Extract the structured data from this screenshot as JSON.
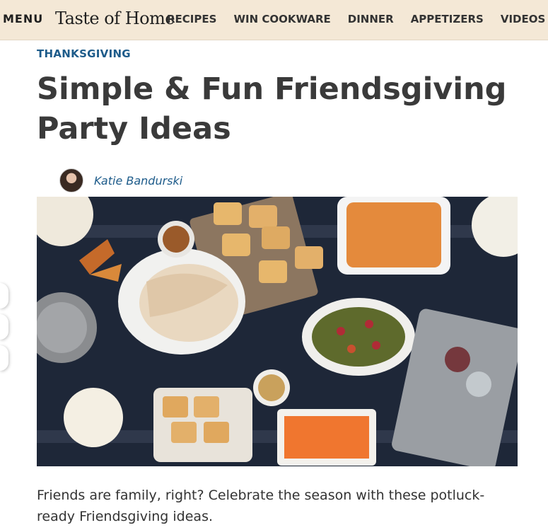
{
  "header": {
    "menu_label": "MENU",
    "logo_text": "Taste of Home",
    "nav": [
      "RECIPES",
      "WIN COOKWARE",
      "DINNER",
      "APPETIZERS",
      "VIDEOS"
    ]
  },
  "article": {
    "category": "THANKSGIVING",
    "title": "Simple & Fun Friendsgiving Party Ideas",
    "author": "Katie Bandurski",
    "intro": "Friends are family, right? Celebrate the season with these potluck-ready Friendsgiving ideas."
  },
  "colors": {
    "header_bg": "#f4e8d6",
    "link_blue": "#1d5b8a",
    "title_gray": "#3a3a3a"
  }
}
